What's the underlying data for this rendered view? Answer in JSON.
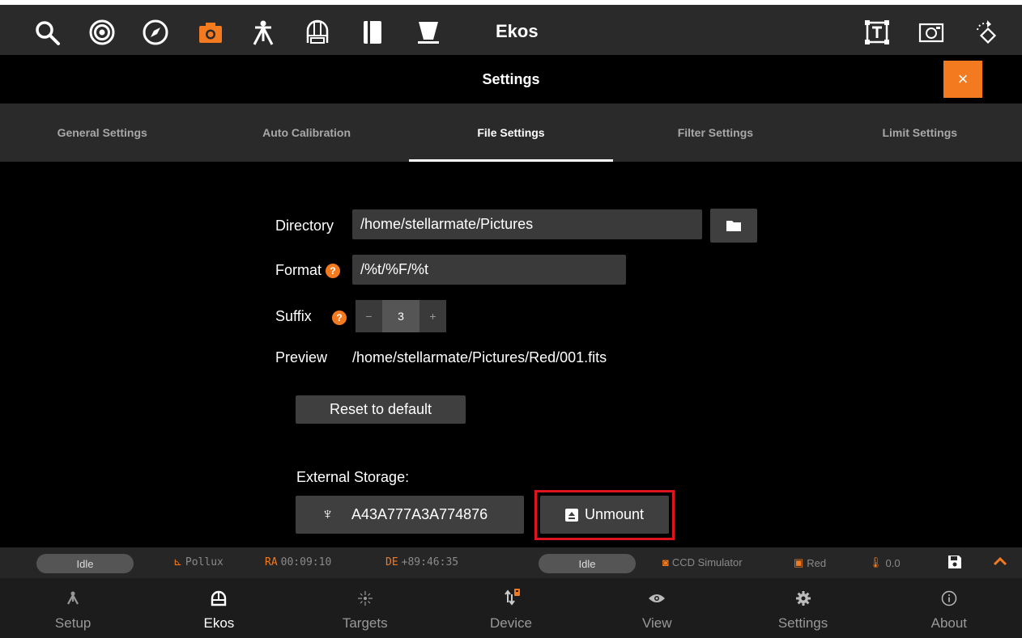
{
  "toolbar": {
    "title": "Ekos",
    "icons": [
      "search-icon",
      "target-icon",
      "compass-icon",
      "camera-icon",
      "mount-icon",
      "observatory-icon",
      "notebook-icon",
      "telescope-icon",
      "text-frame-icon",
      "capture-frame-icon",
      "rotate-icon"
    ],
    "accent": "#f47a1f"
  },
  "settings": {
    "title": "Settings",
    "close_label": "×"
  },
  "tabs": [
    {
      "label": "General Settings"
    },
    {
      "label": "Auto Calibration"
    },
    {
      "label": "File Settings"
    },
    {
      "label": "Filter Settings"
    },
    {
      "label": "Limit Settings"
    }
  ],
  "form": {
    "directory_label": "Directory",
    "directory_value": "/home/stellarmate/Pictures",
    "format_label": "Format",
    "format_value": "/%t/%F/%t",
    "suffix_label": "Suffix",
    "suffix_value": "3",
    "suffix_minus": "−",
    "suffix_plus": "+",
    "help_glyph": "?",
    "preview_label": "Preview",
    "preview_value": "/home/stellarmate/Pictures/Red/001.fits",
    "reset_label": "Reset to default",
    "external_storage_label": "External Storage:",
    "device_id": "A43A777A3A774876",
    "unmount_label": "Unmount"
  },
  "status": {
    "left_state": "Idle",
    "mount": "Pollux",
    "ra_label": "RA",
    "ra_value": "00:09:10",
    "de_label": "DE",
    "de_value": "+89:46:35",
    "right_state": "Idle",
    "camera": "CCD Simulator",
    "filter": "Red",
    "temperature": "0.0"
  },
  "nav": [
    {
      "label": "Setup",
      "icon": "setup-icon"
    },
    {
      "label": "Ekos",
      "icon": "ekos-icon"
    },
    {
      "label": "Targets",
      "icon": "targets-icon"
    },
    {
      "label": "Device",
      "icon": "device-icon"
    },
    {
      "label": "View",
      "icon": "eye-icon"
    },
    {
      "label": "Settings",
      "icon": "gear-icon"
    },
    {
      "label": "About",
      "icon": "info-icon"
    }
  ]
}
